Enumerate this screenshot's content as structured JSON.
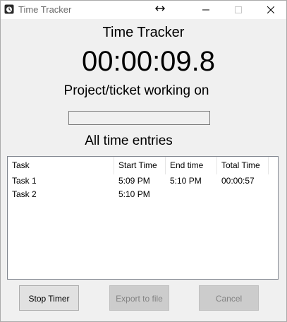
{
  "window": {
    "title": "Time Tracker"
  },
  "main": {
    "title": "Time Tracker",
    "timer": "00:00:09.8",
    "project_label": "Project/ticket working on",
    "project_value": "",
    "entries_label": "All time entries"
  },
  "entries": {
    "columns": [
      "Task",
      "Start Time",
      "End time",
      "Total Time"
    ],
    "rows": [
      {
        "task": "Task 1",
        "start": "5:09 PM",
        "end": "5:10 PM",
        "total": "00:00:57"
      },
      {
        "task": "Task 2",
        "start": "5:10 PM",
        "end": "",
        "total": ""
      }
    ]
  },
  "buttons": {
    "stop": "Stop Timer",
    "export": "Export to file",
    "cancel": "Cancel"
  },
  "icons": {
    "app": "stopwatch-icon",
    "move": "resize-horizontal-icon",
    "minimize": "minimize-icon",
    "maximize": "maximize-icon",
    "close": "close-icon"
  }
}
